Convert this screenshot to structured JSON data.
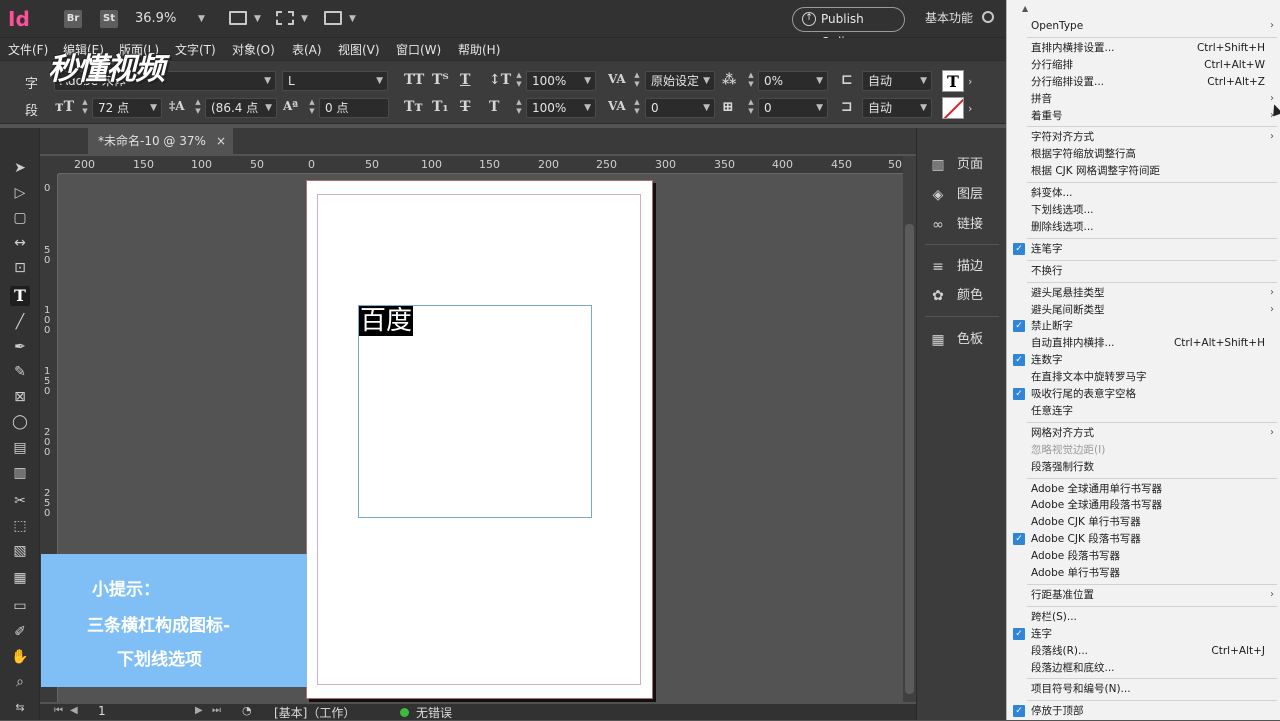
{
  "app": {
    "logo": "Id",
    "bridge": "Br",
    "stock": "St",
    "zoom": "36.9%",
    "publish_label": "Publish Online",
    "workspace_label": "基本功能"
  },
  "menubar": [
    "文件(F)",
    "编辑(E)",
    "版面(L)",
    "文字(T)",
    "对象(O)",
    "表(A)",
    "视图(V)",
    "窗口(W)",
    "帮助(H)"
  ],
  "control": {
    "char_label": "字",
    "para_label": "段",
    "font_family": "Adobe 宋体",
    "font_style": "L",
    "font_size": "72 点",
    "leading": "(86.4 点",
    "baseline_shift": "0 点",
    "vscale": "100%",
    "hscale": "100%",
    "tracking_mode": "原始设定",
    "tracking": "0",
    "tsume": "0%",
    "kerning_extra": "0",
    "auto1": "自动",
    "auto2": "自动"
  },
  "watermark": "秒懂视频",
  "document": {
    "tab_label": "*未命名-10 @ 37%",
    "text_content": "百度"
  },
  "ruler": {
    "h_ticks": [
      "200",
      "150",
      "100",
      "50",
      "0",
      "50",
      "100",
      "150",
      "200",
      "250",
      "300",
      "350",
      "400",
      "450",
      "50"
    ],
    "v_ticks": [
      "0",
      "50",
      "100",
      "150",
      "200",
      "250"
    ]
  },
  "status": {
    "page": "1",
    "style": "[基本]（工作）",
    "errors": "无错误"
  },
  "hint": {
    "line1": "小提示：",
    "line2": "三条横杠构成图标-",
    "line3": "下划线选项"
  },
  "panels": [
    "页面",
    "图层",
    "链接",
    "描边",
    "颜色",
    "色板"
  ],
  "menu": [
    {
      "label": "OpenType",
      "sub": true
    },
    {
      "sep": true
    },
    {
      "label": "直排内横排设置...",
      "shortcut": "Ctrl+Shift+H"
    },
    {
      "label": "分行缩排",
      "shortcut": "Ctrl+Alt+W"
    },
    {
      "label": "分行缩排设置...",
      "shortcut": "Ctrl+Alt+Z"
    },
    {
      "label": "拼音",
      "sub": true
    },
    {
      "label": "着重号",
      "sub": true
    },
    {
      "sep": true
    },
    {
      "label": "字符对齐方式",
      "sub": true
    },
    {
      "label": "根据字符缩放调整行高"
    },
    {
      "label": "根据 CJK 网格调整字符间距"
    },
    {
      "sep": true
    },
    {
      "label": "斜变体..."
    },
    {
      "label": "下划线选项..."
    },
    {
      "label": "删除线选项..."
    },
    {
      "sep": true
    },
    {
      "label": "连笔字",
      "checked": true
    },
    {
      "sep": true
    },
    {
      "label": "不换行"
    },
    {
      "sep": true
    },
    {
      "label": "避头尾悬挂类型",
      "sub": true
    },
    {
      "label": "避头尾间断类型",
      "sub": true
    },
    {
      "label": "禁止断字",
      "checked": true
    },
    {
      "label": "自动直排内横排...",
      "shortcut": "Ctrl+Alt+Shift+H"
    },
    {
      "label": "连数字",
      "checked": true
    },
    {
      "label": "在直排文本中旋转罗马字"
    },
    {
      "label": "吸收行尾的表意字空格",
      "checked": true
    },
    {
      "label": "任意连字"
    },
    {
      "sep": true
    },
    {
      "label": "网格对齐方式",
      "sub": true
    },
    {
      "label": "忽略视觉边距(I)",
      "disabled": true
    },
    {
      "label": "段落强制行数"
    },
    {
      "sep": true
    },
    {
      "label": "Adobe 全球通用单行书写器"
    },
    {
      "label": "Adobe 全球通用段落书写器"
    },
    {
      "label": "Adobe CJK 单行书写器"
    },
    {
      "label": "Adobe CJK 段落书写器",
      "checked": true
    },
    {
      "label": "Adobe 段落书写器"
    },
    {
      "label": "Adobe 单行书写器"
    },
    {
      "sep": true
    },
    {
      "label": "行距基准位置",
      "sub": true
    },
    {
      "sep": true
    },
    {
      "label": "跨栏(S)..."
    },
    {
      "label": "连字",
      "checked": true
    },
    {
      "label": "段落线(R)...",
      "shortcut": "Ctrl+Alt+J"
    },
    {
      "label": "段落边框和底纹..."
    },
    {
      "sep": true
    },
    {
      "label": "项目符号和编号(N)..."
    },
    {
      "sep": true
    },
    {
      "label": "停放于顶部",
      "checked": true
    }
  ]
}
